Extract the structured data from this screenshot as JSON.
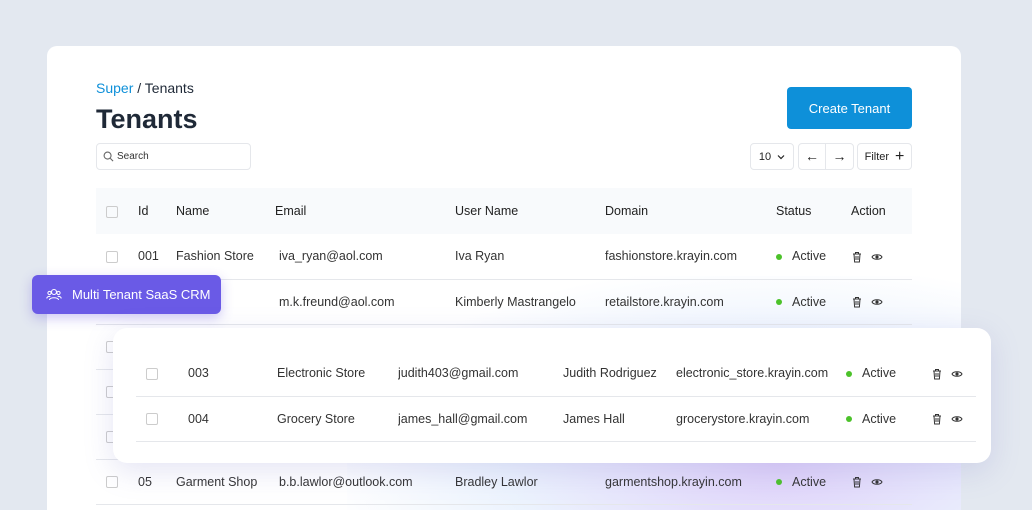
{
  "breadcrumb": {
    "parent": "Super",
    "current": "Tenants"
  },
  "title": "Tenants",
  "create_label": "Create Tenant",
  "search": {
    "placeholder": "Search"
  },
  "per_page": "10",
  "filter_label": "Filter",
  "badge": "Multi Tenant SaaS CRM",
  "columns": [
    "Id",
    "Name",
    "Email",
    "User Name",
    "Domain",
    "Status",
    "Action"
  ],
  "rows": [
    {
      "id": "001",
      "name": "Fashion Store",
      "email": "iva_ryan@aol.com",
      "user": "Iva Ryan",
      "domain": "fashionstore.krayin.com",
      "status": "Active"
    },
    {
      "id": "",
      "name": "Store",
      "email": "m.k.freund@aol.com",
      "user": "Kimberly Mastrangelo",
      "domain": "retailstore.krayin.com",
      "status": "Active"
    },
    {
      "id": "05",
      "name": "Garment Shop",
      "email": "b.b.lawlor@outlook.com",
      "user": "Bradley Lawlor",
      "domain": "garmentshop.krayin.com",
      "status": "Active"
    }
  ],
  "popup_rows": [
    {
      "id": "003",
      "name": "Electronic Store",
      "email": "judith403@gmail.com",
      "user": "Judith Rodriguez",
      "domain": "electronic_store.krayin.com",
      "status": "Active"
    },
    {
      "id": "004",
      "name": "Grocery Store",
      "email": "james_hall@gmail.com",
      "user": "James Hall",
      "domain": "grocerystore.krayin.com",
      "status": "Active"
    }
  ]
}
